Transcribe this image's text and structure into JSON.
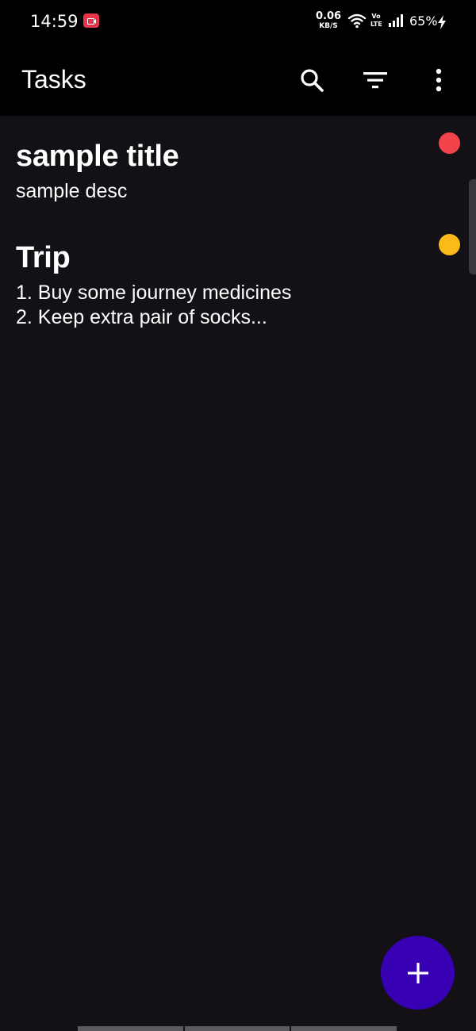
{
  "status_bar": {
    "time": "14:59",
    "speed_value": "0.06",
    "speed_unit": "KB/S",
    "volte_top": "Vo",
    "volte_bottom": "LTE",
    "battery": "65%",
    "icons": [
      "screen-record-icon",
      "wifi-icon",
      "signal-icon",
      "charging-bolt-icon"
    ]
  },
  "app_bar": {
    "title": "Tasks",
    "actions": [
      "search-icon",
      "filter-icon",
      "more-vert-icon"
    ]
  },
  "tasks": [
    {
      "title": "sample title",
      "description": "sample desc",
      "priority_color": "#f2434b"
    },
    {
      "title": "Trip",
      "description": "1. Buy some journey medicines\n2. Keep extra pair of socks...",
      "priority_color": "#fbba18"
    }
  ],
  "fab": {
    "icon": "add-icon",
    "color": "#3700b3"
  },
  "colors": {
    "background": "#131115",
    "bars": "#000000",
    "text": "#ffffff"
  }
}
